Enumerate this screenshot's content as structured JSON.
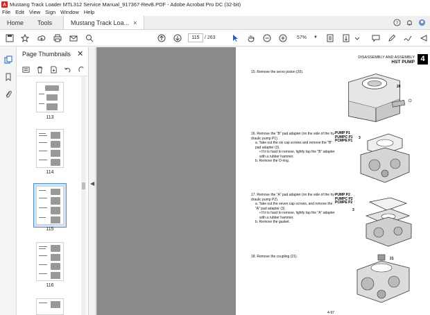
{
  "window": {
    "title": "Mustang Track Loader MTL312 Service Manual_917367-RevB.PDF - Adobe Acrobat Pro DC (32-bit)"
  },
  "menu": {
    "items": [
      "File",
      "Edit",
      "View",
      "Sign",
      "Window",
      "Help"
    ]
  },
  "tabs": {
    "home": "Home",
    "tools": "Tools",
    "document": "Mustang Track Loa...",
    "close": "×"
  },
  "toolbar": {
    "page_current": "115",
    "page_total": "/ 263",
    "zoom": "57%"
  },
  "thumbnails": {
    "header": "Page Thumbnails",
    "close": "✕",
    "pages": [
      "113",
      "114",
      "115",
      "116"
    ],
    "selected": "115"
  },
  "page": {
    "section": "DISASSEMBLY AND ASSEMBLY",
    "subsection": "HST PUMP",
    "chapter": "4",
    "footer": "4-97",
    "steps": {
      "s15": "15.  Remove the servo piston (20).",
      "s16": "16.  Remove the \"B\" pad adapter (on the side of the hy-draulic pump P1).",
      "s16a": "a.  Take out the six cap screws and remove the \"B\" pad adapter (3).",
      "s16b1": "•  If it is hard to remove, lightly tap the \"B\" adapter with a rubber hammer.",
      "s16c": "b.  Remove the O-ring.",
      "s17": "17.  Remove the \"A\" pad adapter (on the side of the hy-draulic pump P2).",
      "s17a": "a.  Take out the seven cap screws, and remove the \"A\" pad adapter (3).",
      "s17b1": "•  If it is hard to remove, lightly tap the \"A\" adapter with a rubber hammer.",
      "s17c": "b.  Remove the gasket.",
      "s18": "18.  Remove the coupling (21)."
    },
    "pump_labels_1": [
      "PUMP P1",
      "PUMPC P1",
      "PCMPE P1"
    ],
    "pump_labels_2": [
      "PUMP P2",
      "PUMPC P2",
      "PCMPE P2"
    ],
    "callouts": {
      "c20": "20",
      "c3a": "3",
      "c3b": "3",
      "c21": "21"
    }
  }
}
